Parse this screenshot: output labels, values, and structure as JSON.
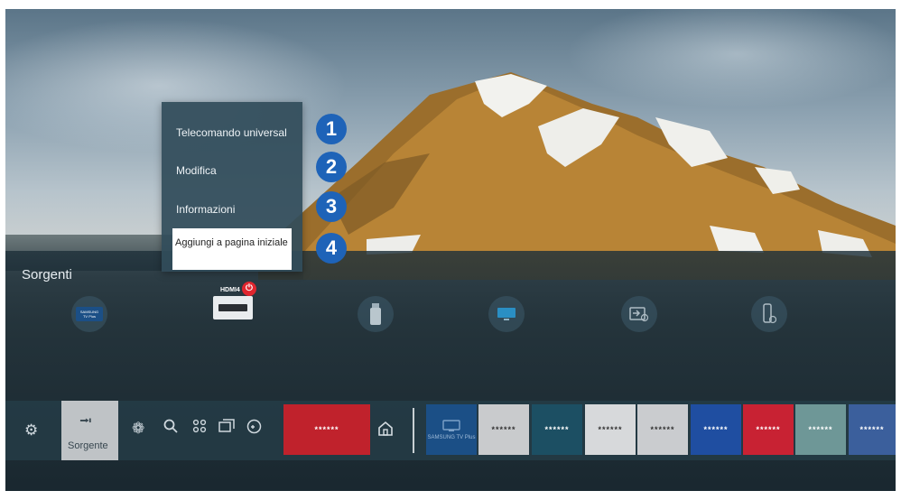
{
  "context_menu": {
    "items": [
      {
        "label": "Telecomando universal",
        "number": "1"
      },
      {
        "label": "Modifica",
        "number": "2"
      },
      {
        "label": "Informazioni",
        "number": "3"
      },
      {
        "label": "Aggiungi a pagina iniziale",
        "number": "4"
      }
    ],
    "focused_index": 3
  },
  "sources": {
    "title": "Sorgenti",
    "items": [
      {
        "name": "samsung-tv-plus",
        "label": "SAMSUNG TV Plus"
      },
      {
        "name": "hdmi4",
        "label": "HDMI4",
        "badge_icon": "power-icon",
        "badge_color": "#e0262e"
      },
      {
        "name": "usb",
        "label": ""
      },
      {
        "name": "screen-mirroring",
        "label": ""
      },
      {
        "name": "connection-guide",
        "label": ""
      },
      {
        "name": "remote-access",
        "label": ""
      }
    ]
  },
  "bottom_bar": {
    "source_label": "Sorgente",
    "icons": [
      "settings-icon",
      "source-icon",
      "ambient-icon",
      "search-icon",
      "apps-icon",
      "multiview-icon",
      "game-icon",
      "home-icon"
    ],
    "tiles": [
      {
        "label": "******",
        "color": "#c0222c"
      },
      {
        "label": "SAMSUNG TV Plus",
        "color": "#1b4f86"
      },
      {
        "label": "******",
        "color": "#c9cbcd"
      },
      {
        "label": "******",
        "color": "#1c4f63"
      },
      {
        "label": "******",
        "color": "#d7d9db"
      },
      {
        "label": "******",
        "color": "#cacccf"
      },
      {
        "label": "******",
        "color": "#1f4ea1"
      },
      {
        "label": "******",
        "color": "#c82233"
      },
      {
        "label": "******",
        "color": "#6e9797"
      },
      {
        "label": "******",
        "color": "#3b5f9c"
      }
    ]
  },
  "colors": {
    "accent_number": "#1e63b8",
    "menu_bg": "#324c5a",
    "power_red": "#e0262e"
  }
}
